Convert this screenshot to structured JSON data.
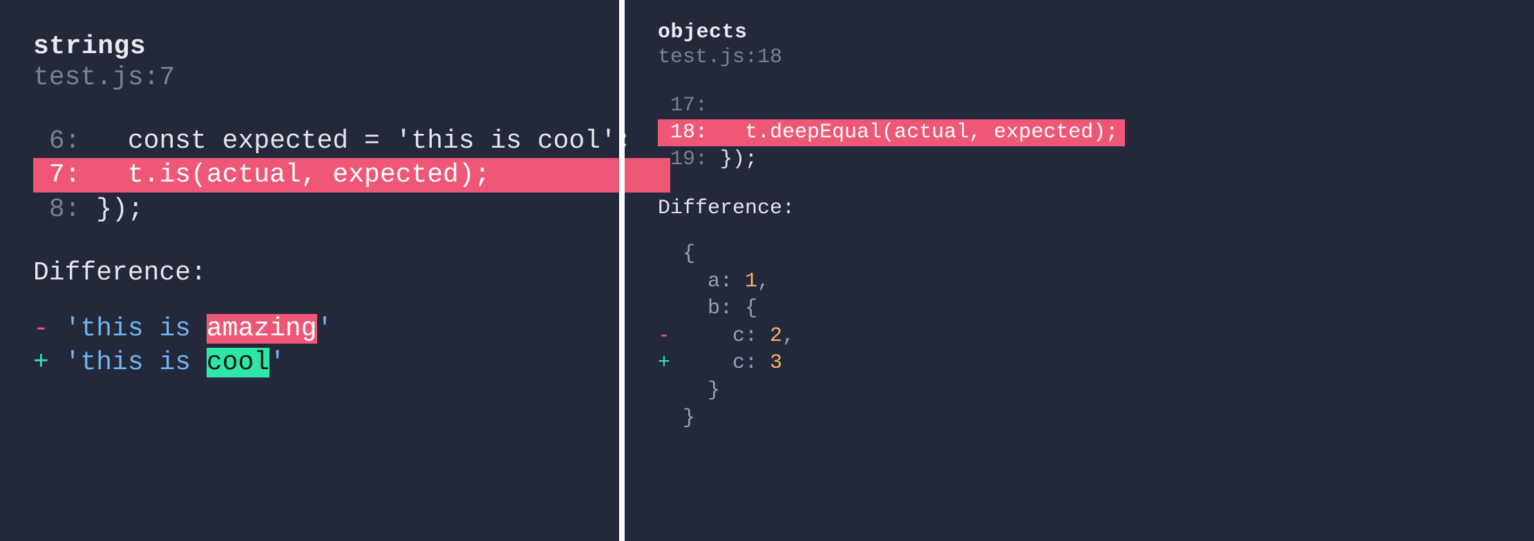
{
  "left": {
    "title": "strings",
    "file": "test.js:7",
    "code": [
      {
        "num": " 6:",
        "text": "   const expected = 'this is cool';",
        "hl": false
      },
      {
        "num": " 7:",
        "text": "   t.is(actual, expected);           ",
        "hl": true
      },
      {
        "num": " 8:",
        "text": " });",
        "hl": false
      }
    ],
    "diff_label": "Difference:",
    "diff": {
      "minus_prefix": "- ",
      "plus_prefix": "+ ",
      "quote": "'",
      "common": "this is ",
      "removed_word": "amazing",
      "added_word": "cool"
    }
  },
  "right": {
    "title": "objects",
    "file": "test.js:18",
    "code": [
      {
        "num": " 17:",
        "text": "",
        "hl": false
      },
      {
        "num": " 18:",
        "text": "   t.deepEqual(actual, expected);",
        "hl": true
      },
      {
        "num": " 19:",
        "text": " });",
        "hl": false
      }
    ],
    "diff_label": "Difference:",
    "obj": {
      "l1": "  {",
      "l2_key": "    a: ",
      "l2_val": "1",
      "l2_comma": ",",
      "l3": "    b: {",
      "l4_sign": "-",
      "l4_key": "     c: ",
      "l4_val": "2",
      "l4_comma": ",",
      "l5_sign": "+",
      "l5_key": "     c: ",
      "l5_val": "3",
      "l6": "    }",
      "l7": "  }"
    }
  }
}
